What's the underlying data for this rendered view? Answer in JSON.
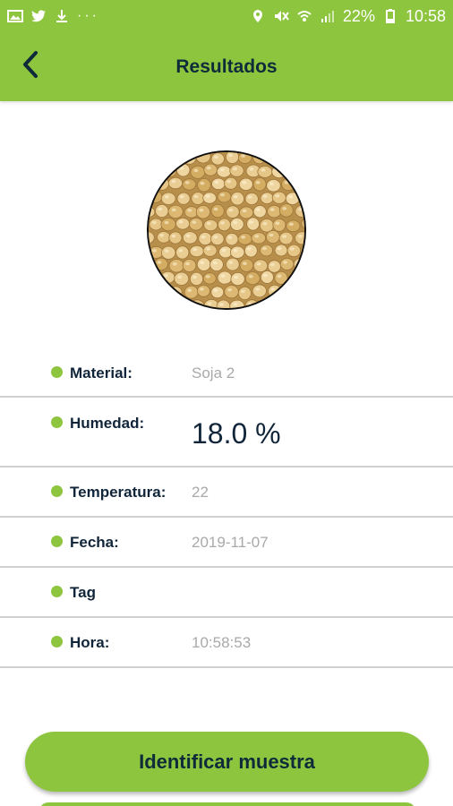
{
  "status_bar": {
    "battery": "22%",
    "time": "10:58",
    "overflow": "···"
  },
  "header": {
    "title": "Resultados"
  },
  "sample": {
    "image": "soybeans"
  },
  "rows": {
    "material": {
      "label": "Material:",
      "value": "Soja 2"
    },
    "humedad": {
      "label": "Humedad:",
      "value": "18.0 %"
    },
    "temperatura": {
      "label": "Temperatura:",
      "value": "22"
    },
    "fecha": {
      "label": "Fecha:",
      "value": "2019-11-07"
    },
    "tag": {
      "label": "Tag",
      "value": ""
    },
    "hora": {
      "label": "Hora:",
      "value": "10:58:53"
    }
  },
  "actions": {
    "identify_label": "Identificar muestra"
  },
  "colors": {
    "accent": "#8dc53e",
    "title": "#0f2b3a",
    "value": "#a9a9a9"
  }
}
